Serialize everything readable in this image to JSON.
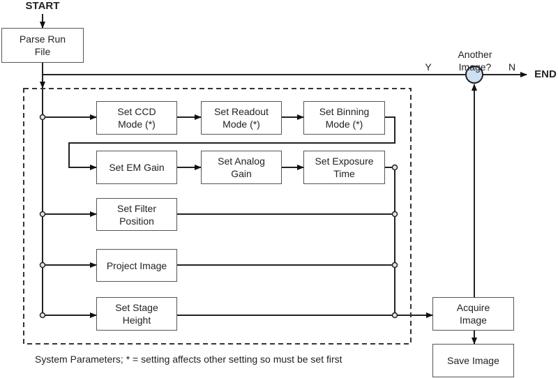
{
  "start": "START",
  "end": "END",
  "decision": {
    "label": "Another\nImage?",
    "yes": "Y",
    "no": "N",
    "fill": "#cfe0f3"
  },
  "nodes": {
    "parse": "Parse Run\nFile",
    "ccd": "Set CCD\nMode (*)",
    "readout": "Set Readout\nMode (*)",
    "binning": "Set Binning\nMode (*)",
    "emgain": "Set EM Gain",
    "analog": "Set Analog\nGain",
    "exposure": "Set Exposure\nTime",
    "filter": "Set Filter\nPosition",
    "project": "Project Image",
    "stage": "Set Stage\nHeight",
    "acquire": "Acquire\nImage",
    "save": "Save Image"
  },
  "caption": "System Parameters; * = setting affects other setting so must be set first"
}
